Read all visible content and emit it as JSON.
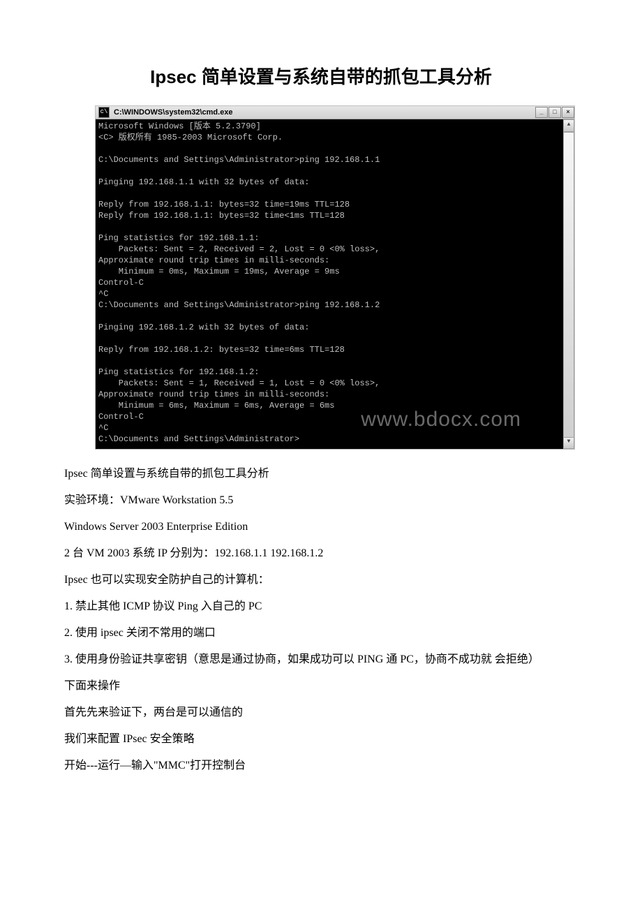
{
  "doc": {
    "title": "Ipsec 简单设置与系统自带的抓包工具分析",
    "terminal": {
      "window_title": "C:\\WINDOWS\\system32\\cmd.exe",
      "icon_label": "cmd-icon",
      "buttons": {
        "min": "_",
        "max": "□",
        "close": "×"
      },
      "scroll": {
        "up": "▲",
        "down": "▼"
      },
      "watermark": "www.bdocx.com",
      "output": "Microsoft Windows [版本 5.2.3790]\n<C> 版权所有 1985-2003 Microsoft Corp.\n\nC:\\Documents and Settings\\Administrator>ping 192.168.1.1\n\nPinging 192.168.1.1 with 32 bytes of data:\n\nReply from 192.168.1.1: bytes=32 time=19ms TTL=128\nReply from 192.168.1.1: bytes=32 time<1ms TTL=128\n\nPing statistics for 192.168.1.1:\n    Packets: Sent = 2, Received = 2, Lost = 0 <0% loss>,\nApproximate round trip times in milli-seconds:\n    Minimum = 0ms, Maximum = 19ms, Average = 9ms\nControl-C\n^C\nC:\\Documents and Settings\\Administrator>ping 192.168.1.2\n\nPinging 192.168.1.2 with 32 bytes of data:\n\nReply from 192.168.1.2: bytes=32 time=6ms TTL=128\n\nPing statistics for 192.168.1.2:\n    Packets: Sent = 1, Received = 1, Lost = 0 <0% loss>,\nApproximate round trip times in milli-seconds:\n    Minimum = 6ms, Maximum = 6ms, Average = 6ms\nControl-C\n^C\nC:\\Documents and Settings\\Administrator>"
    },
    "paragraphs": [
      "Ipsec 简单设置与系统自带的抓包工具分析",
      "实验环境：VMware Workstation 5.5",
      "Windows Server 2003 Enterprise Edition",
      "2 台 VM 2003 系统 IP 分别为：192.168.1.1 192.168.1.2",
      "Ipsec 也可以实现安全防护自己的计算机：",
      "1. 禁止其他 ICMP 协议 Ping 入自己的 PC",
      "2. 使用 ipsec 关闭不常用的端口",
      "3. 使用身份验证共享密钥（意思是通过协商，如果成功可以 PING 通 PC，协商不成功就 会拒绝）",
      "下面来操作",
      "首先先来验证下，两台是可以通信的",
      "我们来配置 IPsec 安全策略",
      "开始---运行—输入\"MMC\"打开控制台"
    ]
  }
}
